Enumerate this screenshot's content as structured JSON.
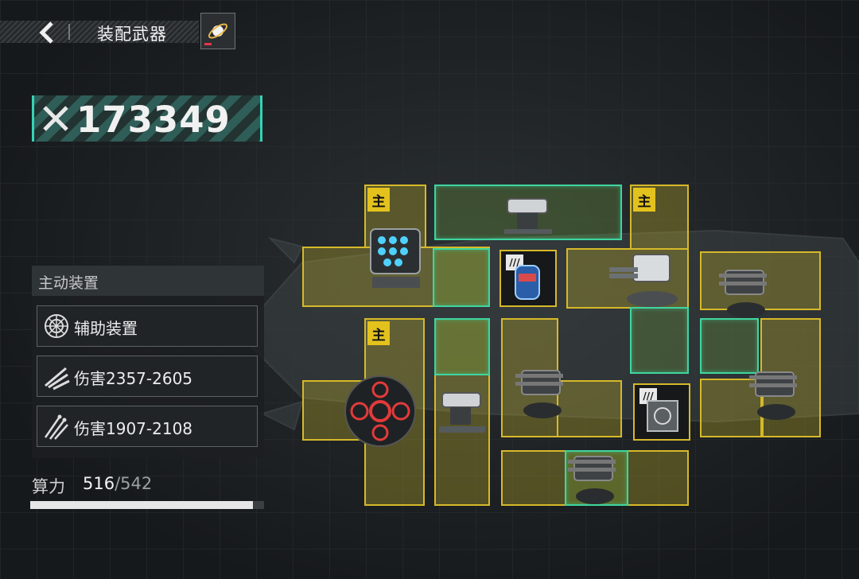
{
  "header": {
    "title": "装配武器",
    "back_icon": "chevron-left-icon",
    "badge_icon": "planet-icon"
  },
  "power": {
    "value": "173349",
    "icon": "crossed-swords-icon",
    "accent": "#35d3b4"
  },
  "panel": {
    "header": "主动装置",
    "items": [
      {
        "label": "辅助装置",
        "icon": "radar-web-icon"
      },
      {
        "label": "伤害2357-2605",
        "icon": "triple-slash-icon"
      },
      {
        "label": "伤害1907-2108",
        "icon": "missile-burst-icon"
      }
    ]
  },
  "compute": {
    "label": "算力",
    "current": "516",
    "separator": "/",
    "max": "542",
    "fill_fraction": 0.952
  },
  "grid": {
    "main_tag": "主",
    "core_tag": "///",
    "weapons": [
      "cluster-missile-pod",
      "twin-cannon",
      "gatling-turret",
      "twin-turret",
      "spherical-core",
      "twin-cannon",
      "twin-turret",
      "twin-turret",
      "twin-turret"
    ],
    "cores": [
      "energy-capsule",
      "circuit-module"
    ]
  },
  "colors": {
    "slot_yellow": "#d6b92a",
    "slot_green": "#3fd5a0",
    "tag_yellow": "#e3c21e"
  }
}
